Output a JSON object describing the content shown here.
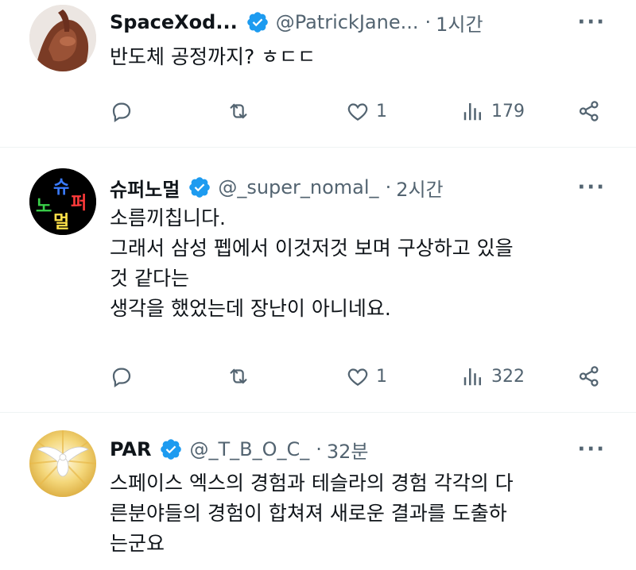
{
  "tweets": [
    {
      "name": "SpaceXod...",
      "handle": "@PatrickJane...",
      "separator": "·",
      "time": "1시간",
      "text": "반도체 공정까지? ㅎㄷㄷ",
      "replies": "",
      "retweets": "",
      "likes": "1",
      "views": "179",
      "avatar_icon": "hands-photo-avatar"
    },
    {
      "name": "슈퍼노멀",
      "handle": "@_super_nomal_",
      "separator": "·",
      "time": "2시간",
      "text": "소름끼칩니다.\n그래서 삼성 펩에서 이것저것 보며 구상하고 있을\n것 같다는\n생각을 했었는데 장난이 아니네요.",
      "replies": "",
      "retweets": "",
      "likes": "1",
      "views": "322",
      "avatar_text": [
        "슈",
        "퍼",
        "노",
        "멀"
      ]
    },
    {
      "name": "PAR",
      "handle": "@_T_B_O_C_",
      "separator": "·",
      "time": "32분",
      "text": "스페이스 엑스의 경험과 테슬라의 경험 각각의 다\n른분야들의 경험이 합쳐져 새로운 결과를 도출하\n는군요",
      "avatar_icon": "dove-sunburst-avatar"
    }
  ],
  "more_icon": "···",
  "colors": {
    "verified": "#1d9bf0",
    "secondary_text": "#536471",
    "divider": "#eff3f4"
  }
}
